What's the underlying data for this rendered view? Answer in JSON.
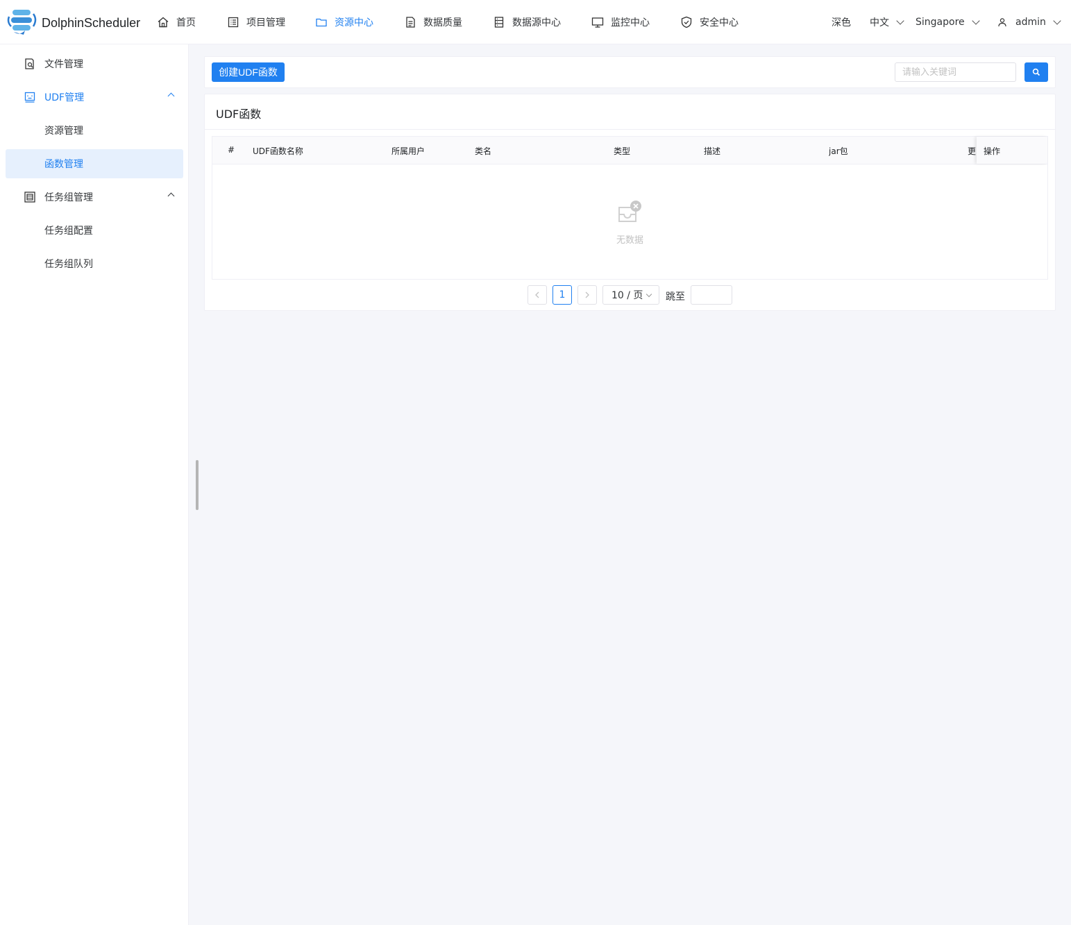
{
  "app": {
    "logo_text": "DolphinScheduler"
  },
  "nav": {
    "items": [
      {
        "label": "首页",
        "icon": "home-icon"
      },
      {
        "label": "项目管理",
        "icon": "project-icon"
      },
      {
        "label": "资源中心",
        "icon": "folder-icon",
        "active": true
      },
      {
        "label": "数据质量",
        "icon": "data-quality-icon"
      },
      {
        "label": "数据源中心",
        "icon": "datasource-icon"
      },
      {
        "label": "监控中心",
        "icon": "monitor-icon"
      },
      {
        "label": "安全中心",
        "icon": "shield-icon"
      }
    ],
    "theme_label": "深色",
    "language": "中文",
    "timezone": "Singapore",
    "user": "admin"
  },
  "sidebar": {
    "items": [
      {
        "label": "文件管理",
        "icon": "file-search-icon"
      },
      {
        "label": "UDF管理",
        "icon": "udf-icon",
        "expanded": true
      },
      {
        "label": "资源管理"
      },
      {
        "label": "函数管理",
        "selected": true
      },
      {
        "label": "任务组管理",
        "icon": "task-group-icon",
        "expanded": true
      },
      {
        "label": "任务组配置"
      },
      {
        "label": "任务组队列"
      }
    ]
  },
  "toolbar": {
    "create_label": "创建UDF函数",
    "search_placeholder": "请输入关键词",
    "search_value": ""
  },
  "table": {
    "title": "UDF函数",
    "columns": [
      "#",
      "UDF函数名称",
      "所属用户",
      "类名",
      "类型",
      "描述",
      "jar包",
      "更",
      "操作"
    ],
    "rows": [],
    "empty_text": "无数据"
  },
  "pagination": {
    "current_page": "1",
    "page_size_label": "10 / 页",
    "jump_label": "跳至",
    "jump_value": ""
  },
  "colors": {
    "accent": "#2080f0",
    "background": "#f5f6fa",
    "selected_bg": "#e6f0fd"
  }
}
